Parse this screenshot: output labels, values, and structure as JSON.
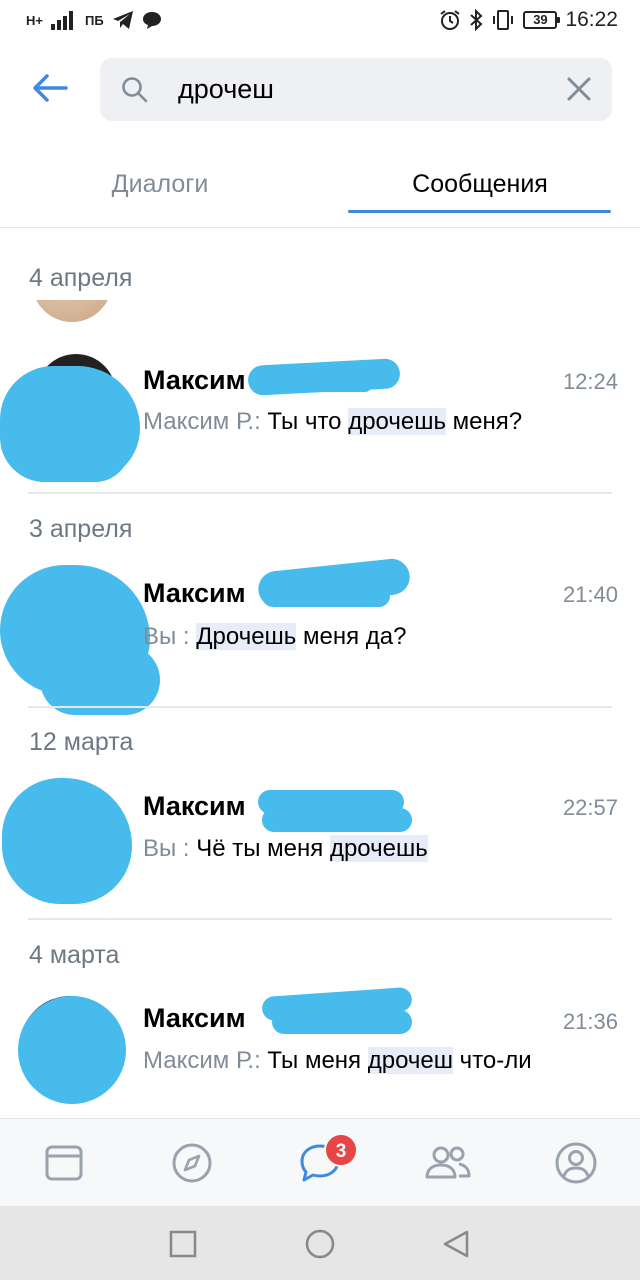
{
  "status_bar": {
    "network": "H+",
    "carrier_icons": "ПБ",
    "battery": "39",
    "time": "16:22"
  },
  "search": {
    "query": "дрочеш",
    "icons": [
      "back-arrow-icon",
      "search-icon",
      "close-icon"
    ]
  },
  "tabs": [
    {
      "label": "Диалоги",
      "active": false
    },
    {
      "label": "Сообщения",
      "active": true
    }
  ],
  "groups": [
    {
      "date": "4 апреля"
    },
    {
      "date": "",
      "name": "Максим",
      "time": "12:24",
      "sender": "Максим Р.:",
      "text_before": " Ты что ",
      "highlight": "дрочешь",
      "text_after": " меня?"
    },
    {
      "date": "3 апреля",
      "name": "Максим",
      "time": "21:40",
      "sender": "Вы :",
      "text_before": " ",
      "highlight": "Дрочешь",
      "text_after": " меня да?"
    },
    {
      "date": "12 марта",
      "name": "Максим",
      "time": "22:57",
      "sender": "Вы :",
      "text_before": " Чё ты меня ",
      "highlight": "дрочешь",
      "text_after": ""
    },
    {
      "date": "4 марта",
      "name": "Максим",
      "time": "21:36",
      "sender": "Максим Р.:",
      "text_before": " Ты меня ",
      "highlight": "дрочеш",
      "text_after": " что-ли"
    }
  ],
  "bottom_nav": {
    "items": [
      "newsfeed-icon",
      "explore-icon",
      "messages-icon",
      "friends-icon",
      "profile-icon"
    ],
    "messages_badge": "3"
  },
  "colors": {
    "accent": "#3f8ae0",
    "redaction": "#47bbec",
    "badge": "#e64646",
    "secondary_text": "#818c99"
  }
}
